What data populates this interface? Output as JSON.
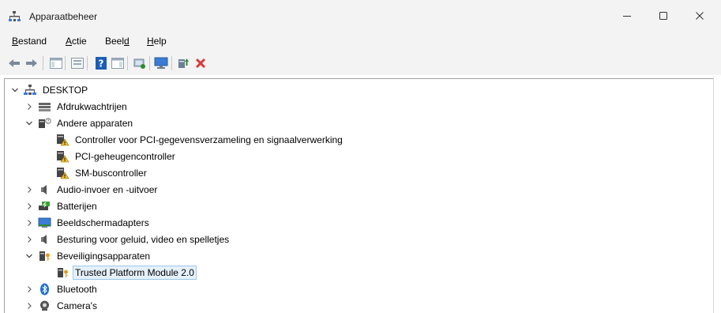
{
  "window": {
    "title": "Apparaatbeheer",
    "icon": "device-manager-icon"
  },
  "menu": {
    "items": [
      {
        "label_pre": "",
        "label_ul": "B",
        "label_post": "estand"
      },
      {
        "label_pre": "",
        "label_ul": "A",
        "label_post": "ctie"
      },
      {
        "label_pre": "Beel",
        "label_ul": "d",
        "label_post": ""
      },
      {
        "label_pre": "",
        "label_ul": "H",
        "label_post": "elp"
      }
    ]
  },
  "toolbar": {
    "buttons": [
      "back-arrow-icon",
      "forward-arrow-icon",
      "show-hide-console-tree-icon",
      "properties-icon",
      "help-icon",
      "action-pane-icon",
      "scan-hardware-icon",
      "monitor-icon",
      "update-driver-icon",
      "uninstall-device-icon"
    ],
    "colors": {
      "uninstall": "#d83b3b",
      "help": "#1a5fb4",
      "update": "#2e8b2e"
    }
  },
  "tree": {
    "root": {
      "label": "DESKTOP"
    },
    "nodes": [
      {
        "label": "Afdrukwachtrijen",
        "expanded": false,
        "icon": "printer-queue-icon"
      },
      {
        "label": "Andere apparaten",
        "expanded": true,
        "icon": "other-devices-icon",
        "children": [
          {
            "label": "Controller voor PCI-gegevensverzameling en signaalverwerking",
            "icon": "unknown-device-warning-icon"
          },
          {
            "label": "PCI-geheugencontroller",
            "icon": "unknown-device-warning-icon"
          },
          {
            "label": "SM-buscontroller",
            "icon": "unknown-device-warning-icon"
          }
        ]
      },
      {
        "label": "Audio-invoer en -uitvoer",
        "expanded": false,
        "icon": "speaker-icon"
      },
      {
        "label": "Batterijen",
        "expanded": false,
        "icon": "battery-icon"
      },
      {
        "label": "Beeldschermadapters",
        "expanded": false,
        "icon": "display-adapter-icon"
      },
      {
        "label": "Besturing voor geluid, video en spelletjes",
        "expanded": false,
        "icon": "sound-controller-icon"
      },
      {
        "label": "Beveiligingsapparaten",
        "expanded": true,
        "icon": "security-device-icon",
        "children": [
          {
            "label": "Trusted Platform Module 2.0",
            "icon": "security-device-icon",
            "selected": true
          }
        ]
      },
      {
        "label": "Bluetooth",
        "expanded": false,
        "icon": "bluetooth-icon"
      },
      {
        "label": "Camera's",
        "expanded": false,
        "icon": "camera-icon"
      }
    ]
  }
}
